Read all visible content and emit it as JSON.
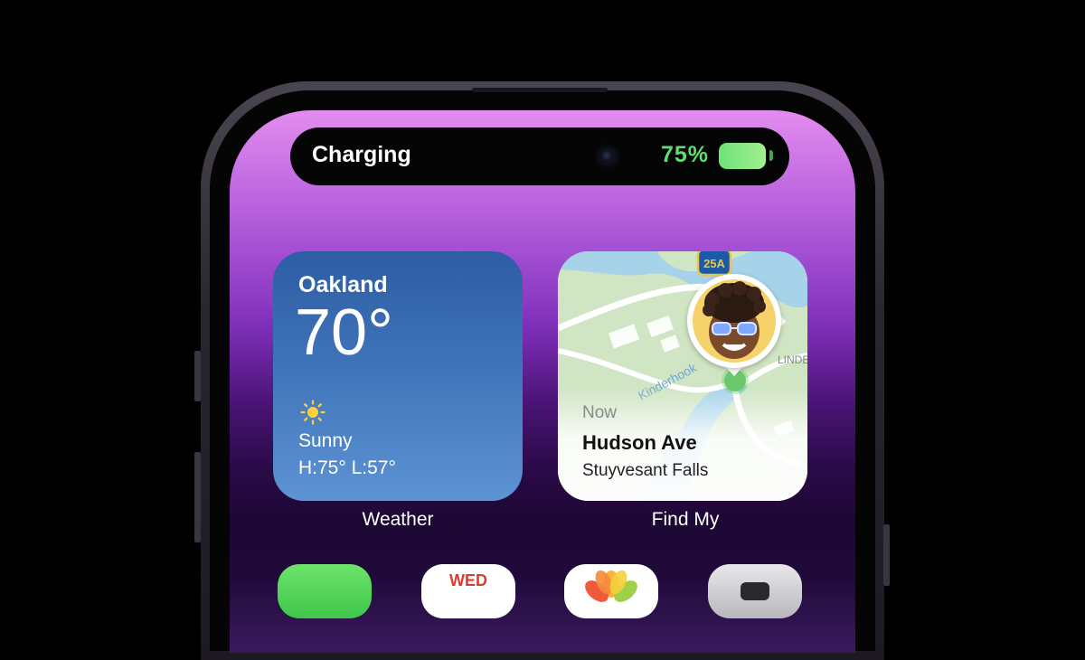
{
  "dynamic_island": {
    "status": "Charging",
    "battery_percent": "75%",
    "battery_level": 0.75,
    "accent_color": "#5fe06d"
  },
  "weather_widget": {
    "city": "Oakland",
    "temperature": "70°",
    "condition": "Sunny",
    "range": "H:75° L:57°",
    "icon": "sun-icon",
    "label": "Weather"
  },
  "findmy_widget": {
    "time": "Now",
    "place": "Hudson Ave",
    "area": "Stuyvesant Falls",
    "route_shield": "25A",
    "road_label_1": "Kinderhook",
    "road_label_2": "LINDE",
    "label": "Find My"
  },
  "dock_apps": [
    {
      "name": "messages-app-icon"
    },
    {
      "name": "calendar-app-icon",
      "day": "WED"
    },
    {
      "name": "photos-app-icon"
    },
    {
      "name": "camera-app-icon"
    }
  ]
}
